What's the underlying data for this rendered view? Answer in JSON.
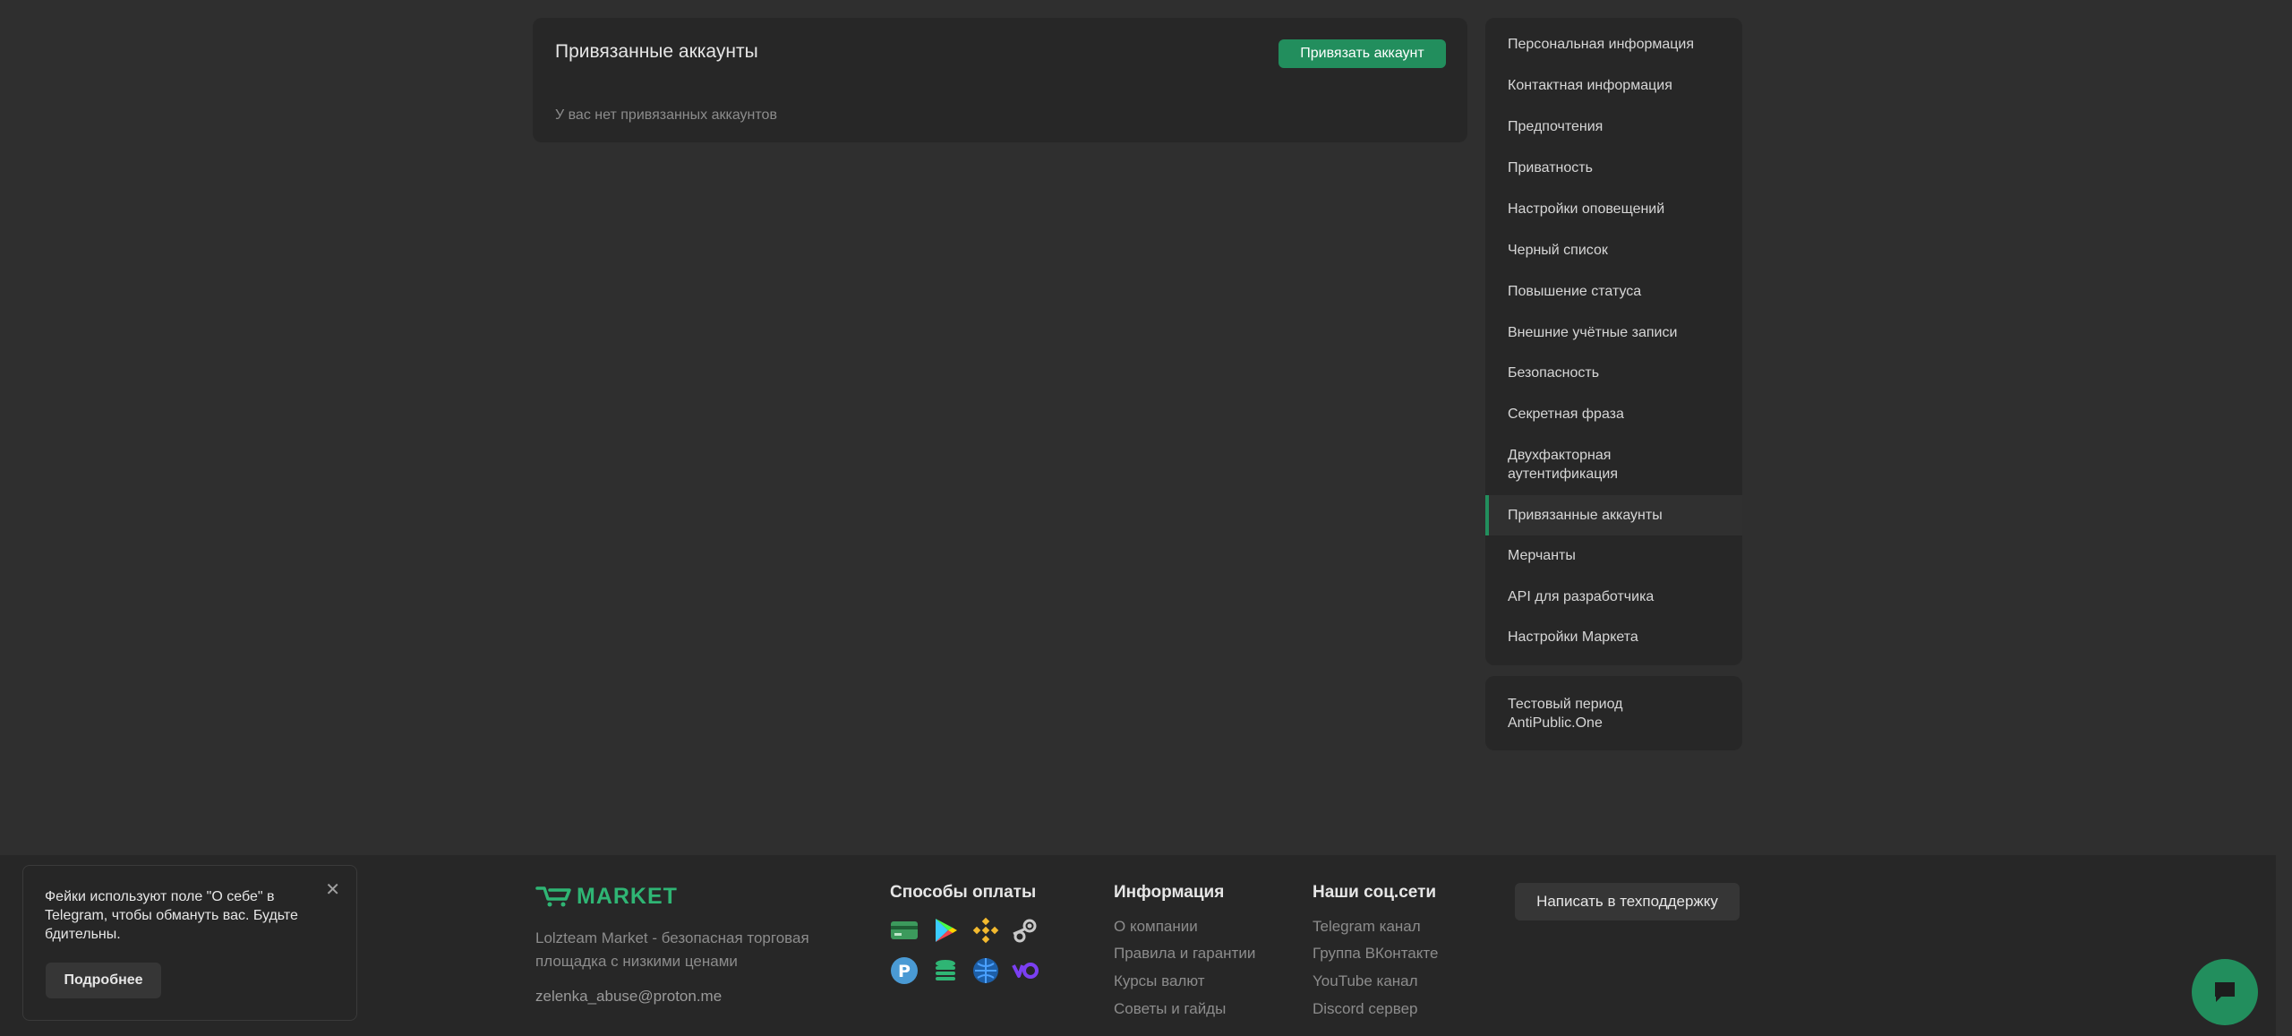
{
  "main": {
    "title": "Привязанные аккаунты",
    "link_button": "Привязать аккаунт",
    "empty_text": "У вас нет привязанных аккаунтов"
  },
  "sidebar": {
    "items": [
      {
        "label": "Персональная информация"
      },
      {
        "label": "Контактная информация"
      },
      {
        "label": "Предпочтения"
      },
      {
        "label": "Приватность"
      },
      {
        "label": "Настройки оповещений"
      },
      {
        "label": "Черный список"
      },
      {
        "label": "Повышение статуса"
      },
      {
        "label": "Внешние учётные записи"
      },
      {
        "label": "Безопасность"
      },
      {
        "label": "Секретная фраза"
      },
      {
        "label": "Двухфакторная аутентификация"
      },
      {
        "label": "Привязанные аккаунты",
        "active": true
      },
      {
        "label": "Мерчанты"
      },
      {
        "label": "API для разработчика"
      },
      {
        "label": "Настройки Маркета"
      }
    ],
    "extra_item": "Тестовый период AntiPublic.One"
  },
  "footer": {
    "logo_text": "MARKET",
    "description": "Lolzteam Market - безопасная торговая площадка с низкими ценами",
    "email": "zelenka_abuse@proton.me",
    "payments_title": "Способы оплаты",
    "payment_icons": [
      "card-icon",
      "google-play-icon",
      "binance-icon",
      "steam-icon",
      "p-coin-icon",
      "coins-icon",
      "webmoney-icon",
      "yoomoney-icon"
    ],
    "info_title": "Информация",
    "info_links": [
      "О компании",
      "Правила и гарантии",
      "Курсы валют",
      "Советы и гайды"
    ],
    "social_title": "Наши соц.сети",
    "social_links": [
      "Telegram канал",
      "Группа ВКонтакте",
      "YouTube канал",
      "Discord сервер"
    ],
    "support_button": "Написать в техподдержку"
  },
  "toast": {
    "text": "Фейки используют поле \"О себе\" в Telegram, чтобы обмануть вас. Будьте бдительны.",
    "button": "Подробнее"
  },
  "colors": {
    "accent": "#228e5d",
    "background": "#2f2f2f",
    "panel": "#272727"
  }
}
